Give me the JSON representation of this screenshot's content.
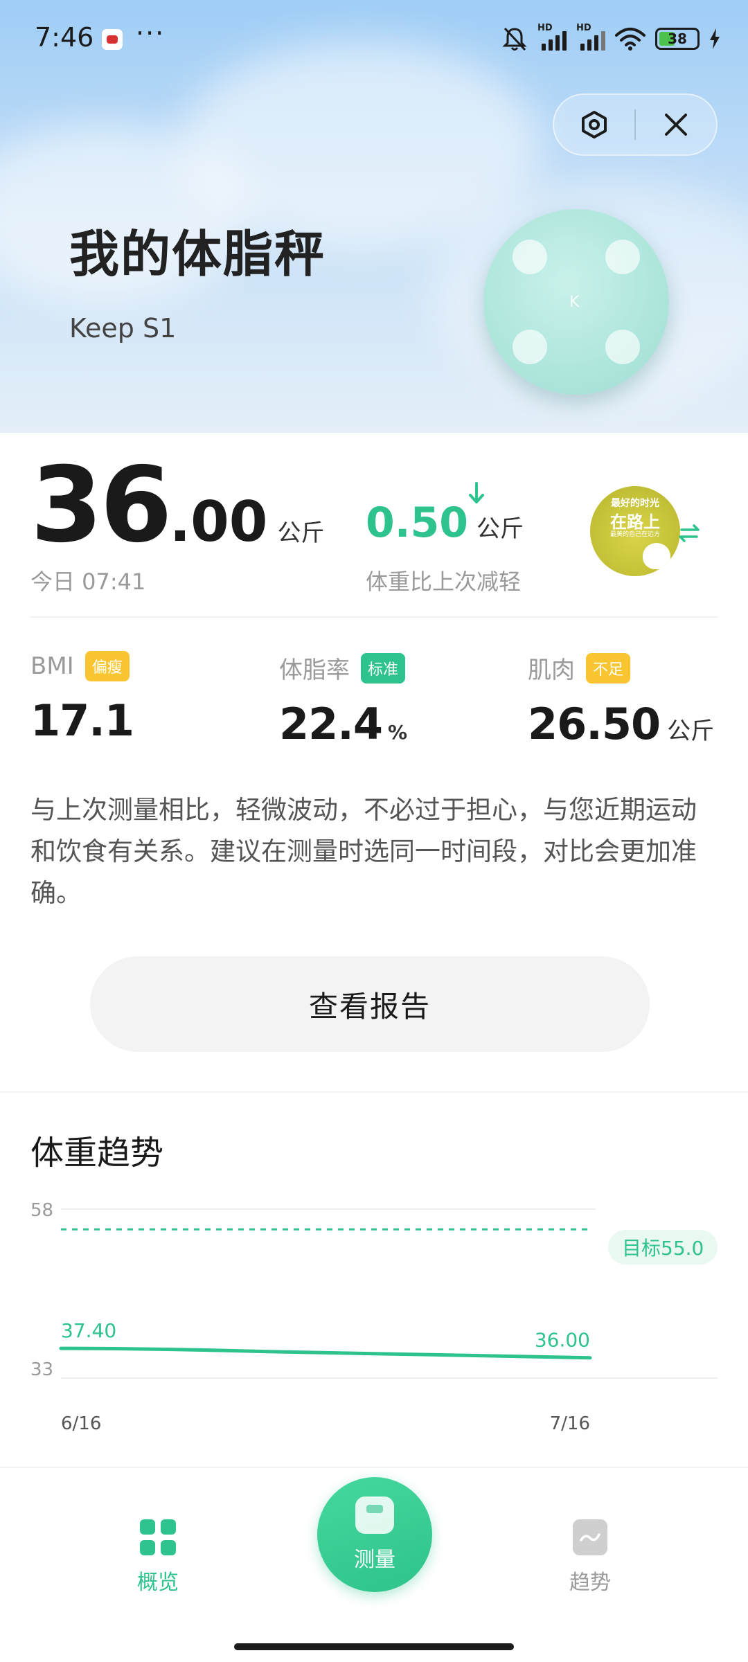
{
  "status_bar": {
    "time": "7:46",
    "more": "···",
    "battery": "38"
  },
  "header": {
    "title": "我的体脂秤",
    "device_model": "Keep S1",
    "scale_logo": "K"
  },
  "summary": {
    "weight_int": "36",
    "weight_dec": ".00",
    "weight_unit": "公斤",
    "measured_at": "今日 07:41",
    "delta_value": "0.50",
    "delta_unit": "公斤",
    "delta_label": "体重比上次减轻",
    "avatar_text": {
      "line1": "最好的时光",
      "line2": "在路上",
      "line3": "最美的自己在远方"
    }
  },
  "metrics": [
    {
      "label": "BMI",
      "tag": "偏瘦",
      "tag_color": "#f9c531",
      "value": "17.1",
      "unit": ""
    },
    {
      "label": "体脂率",
      "tag": "标准",
      "tag_color": "#2ec38c",
      "value": "22.4",
      "unit": "%"
    },
    {
      "label": "肌肉",
      "tag": "不足",
      "tag_color": "#f9c531",
      "value": "26.50",
      "unit": "公斤"
    }
  ],
  "advice": "与上次测量相比，轻微波动，不必过于担心，与您近期运动和饮食有关系。建议在测量时选同一时间段，对比会更加准确。",
  "report_button": "查看报告",
  "trend": {
    "title": "体重趋势",
    "goal_label": "目标55.0"
  },
  "chart_data": {
    "type": "line",
    "title": "体重趋势",
    "x": [
      "6/16",
      "7/16"
    ],
    "y_ticks": [
      "58",
      "33"
    ],
    "ylim": [
      33,
      58
    ],
    "series": [
      {
        "values": [
          37.4,
          37.35,
          37.25,
          37.1,
          36.9,
          36.75,
          36.6,
          36.45,
          36.3,
          36.15,
          36.0
        ]
      }
    ],
    "point_labels": [
      "37.40",
      "36.00"
    ],
    "goal": 55.0,
    "goal_label": "目标55.0",
    "line_color": "#2ec38c",
    "grid": true
  },
  "bottom_nav": {
    "overview": "概览",
    "measure": "测量",
    "trend": "趋势"
  },
  "colors": {
    "accent": "#2ec38c",
    "warning": "#f9c531",
    "muted": "#9a9a9a"
  },
  "icons": {
    "settings": "hexagon-settings-icon",
    "close": "close-icon",
    "down": "arrow-down-icon",
    "swap": "swap-icon",
    "overview": "grid-icon",
    "measure": "scale-icon",
    "trend": "trend-icon"
  }
}
